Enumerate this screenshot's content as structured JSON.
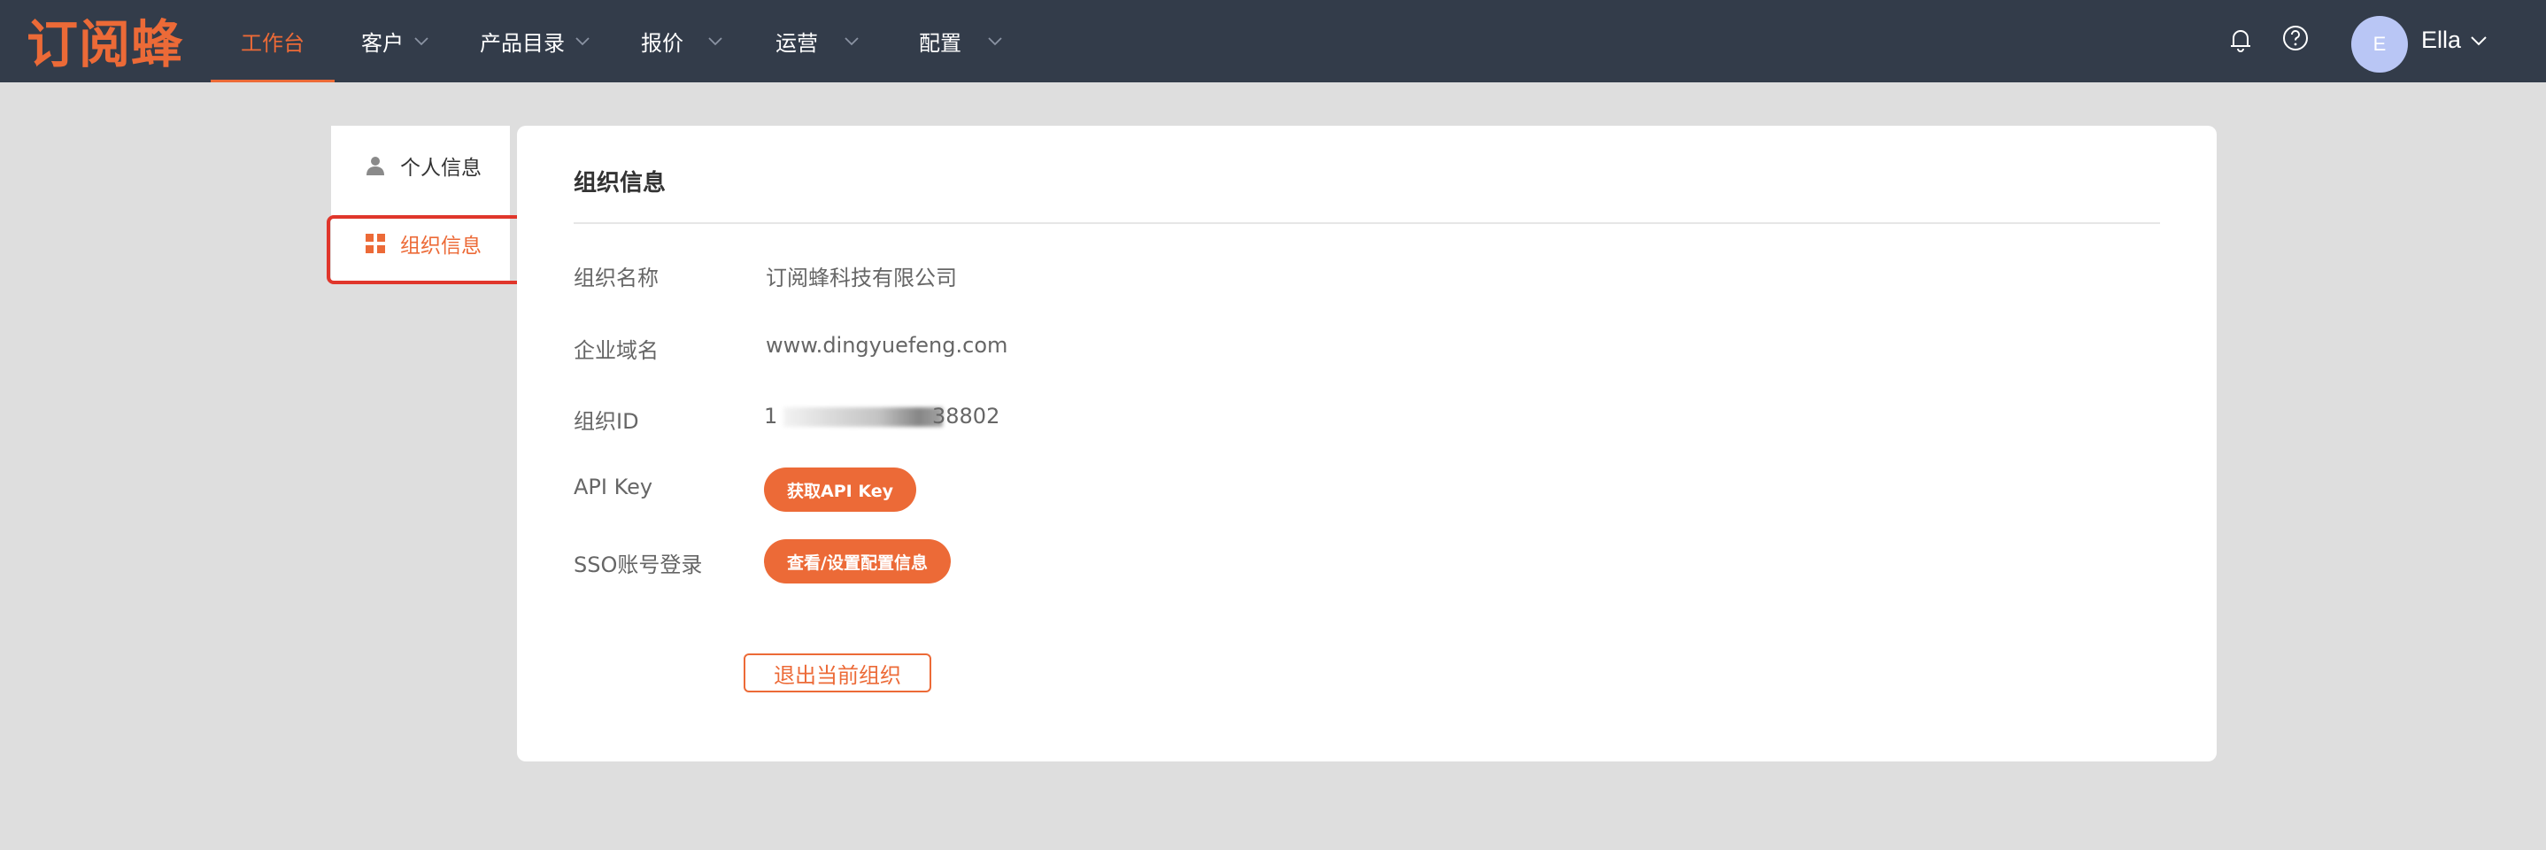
{
  "app": {
    "logo_text": "订阅蜂"
  },
  "nav": {
    "items": [
      {
        "label": "工作台",
        "active": true,
        "has_dropdown": false
      },
      {
        "label": "客户",
        "active": false,
        "has_dropdown": true
      },
      {
        "label": "产品目录",
        "active": false,
        "has_dropdown": true
      },
      {
        "label": "报价",
        "active": false,
        "has_dropdown": true
      },
      {
        "label": "运营",
        "active": false,
        "has_dropdown": true
      },
      {
        "label": "配置",
        "active": false,
        "has_dropdown": true
      }
    ]
  },
  "user": {
    "avatar_letter": "E",
    "name": "Ella"
  },
  "side_menu": {
    "items": [
      {
        "label": "个人信息",
        "icon": "person-icon",
        "active": false
      },
      {
        "label": "组织信息",
        "icon": "grid-icon",
        "active": true
      }
    ]
  },
  "org": {
    "title": "组织信息",
    "name_label": "组织名称",
    "name_value": "订阅蜂科技有限公司",
    "domain_label": "企业域名",
    "domain_value": "www.dingyuefeng.com",
    "id_label": "组织ID",
    "id_prefix": "1",
    "id_suffix": "38802",
    "api_key_label": "API Key",
    "api_key_button": "获取API Key",
    "sso_label": "SSO账号登录",
    "sso_button": "查看/设置配置信息",
    "exit_button": "退出当前组织"
  },
  "colors": {
    "accent": "#ec6a37",
    "topbar": "#333c4a",
    "highlight": "#e0362b"
  }
}
